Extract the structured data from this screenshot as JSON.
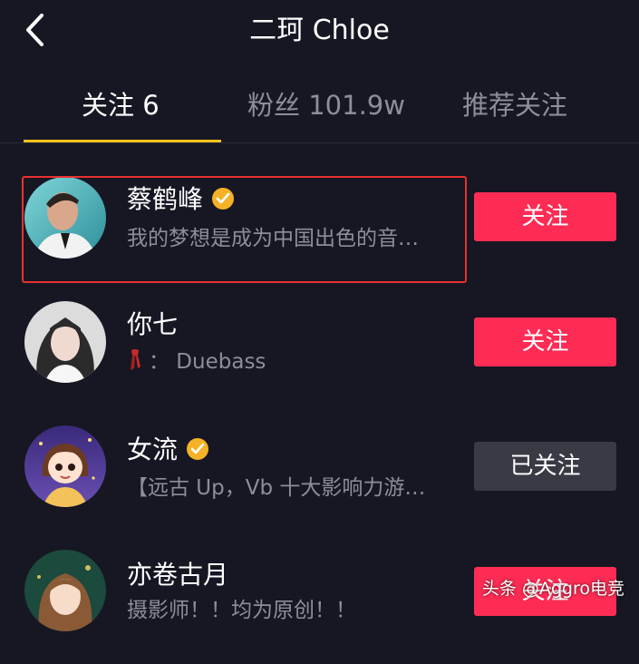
{
  "header": {
    "title": "二珂 Chloe",
    "back_icon": "chevron-left-icon"
  },
  "tabs": [
    {
      "label": "关注 6",
      "active": true
    },
    {
      "label": "粉丝 101.9w",
      "active": false
    },
    {
      "label": "推荐关注",
      "active": false
    }
  ],
  "colors": {
    "accent_underline": "#f6c31b",
    "follow_button": "#fe2c55",
    "followed_button": "#393a44",
    "verified_badge": "#f5b226",
    "highlight_border": "#e8312f"
  },
  "users": [
    {
      "name": "蔡鹤峰",
      "verified": true,
      "desc": "我的梦想是成为中国出色的音…",
      "button": "关注",
      "followed": false
    },
    {
      "name": "你七",
      "verified": false,
      "desc_icon": "scarf-icon",
      "desc": "： Duebass",
      "button": "关注",
      "followed": false
    },
    {
      "name": "女流",
      "verified": true,
      "desc": "【远古 Up，Vb 十大影响力游…",
      "button": "已关注",
      "followed": true
    },
    {
      "name": "亦卷古月",
      "verified": false,
      "desc": "摄影师！！均为原创！！",
      "button": "关注",
      "followed": false
    }
  ],
  "watermark": "头条 @Aggro电竞"
}
